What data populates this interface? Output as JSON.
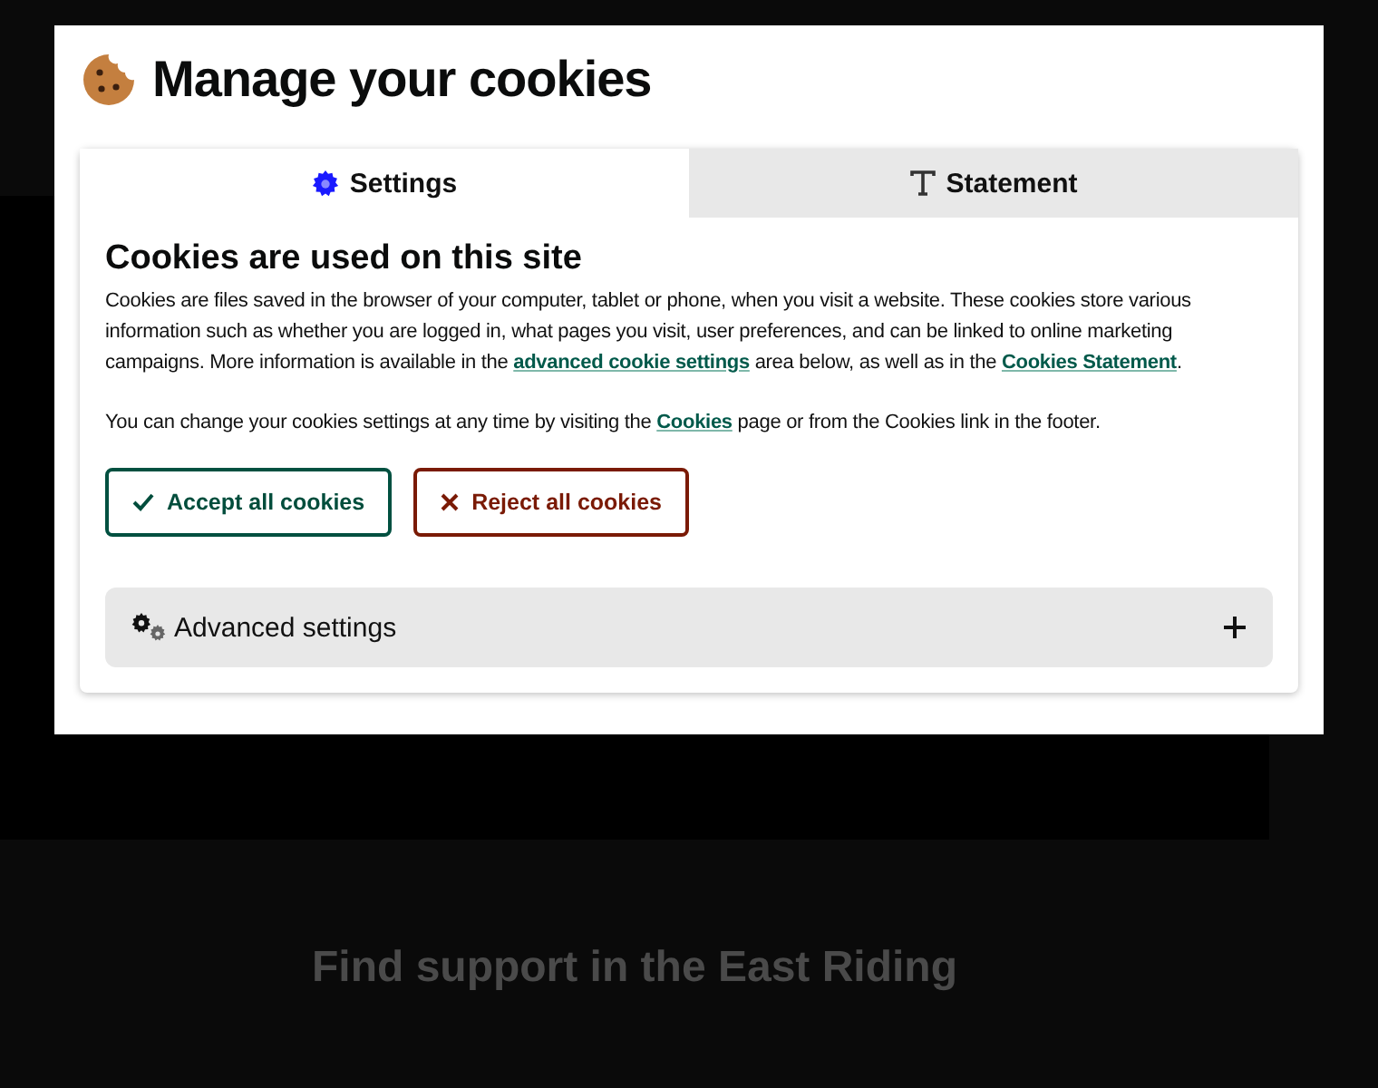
{
  "background": {
    "heading": "Find support in the East Riding"
  },
  "dialog": {
    "title": "Manage your cookies",
    "tabs": [
      {
        "label": "Settings",
        "kind": "gear",
        "selected": true
      },
      {
        "label": "Statement",
        "kind": "text",
        "selected": false
      }
    ],
    "heading": "Cookies are used on this site",
    "paragraphs": [
      [
        {
          "kind": "text",
          "text": "Cookies are files saved in the browser of your computer, tablet or phone, when you visit a website. These cookies store various information such as whether you are logged in, what pages you visit, user preferences, and can be linked to online marketing campaigns. More information is available in the "
        },
        {
          "kind": "link",
          "text": "advanced cookie settings"
        },
        {
          "kind": "text",
          "text": " area below, as well as in the "
        },
        {
          "kind": "link",
          "text": "Cookies Statement"
        },
        {
          "kind": "text",
          "text": "."
        }
      ],
      [
        {
          "kind": "text",
          "text": "You can change your cookies settings at any time by visiting the "
        },
        {
          "kind": "link",
          "text": "Cookies"
        },
        {
          "kind": "text",
          "text": " page or from the Cookies link in the footer."
        }
      ]
    ],
    "buttons": [
      {
        "label": "Accept all cookies",
        "kind": "accept"
      },
      {
        "label": "Reject all cookies",
        "kind": "reject"
      }
    ],
    "accordion": {
      "label": "Advanced settings",
      "expanded": false
    }
  }
}
